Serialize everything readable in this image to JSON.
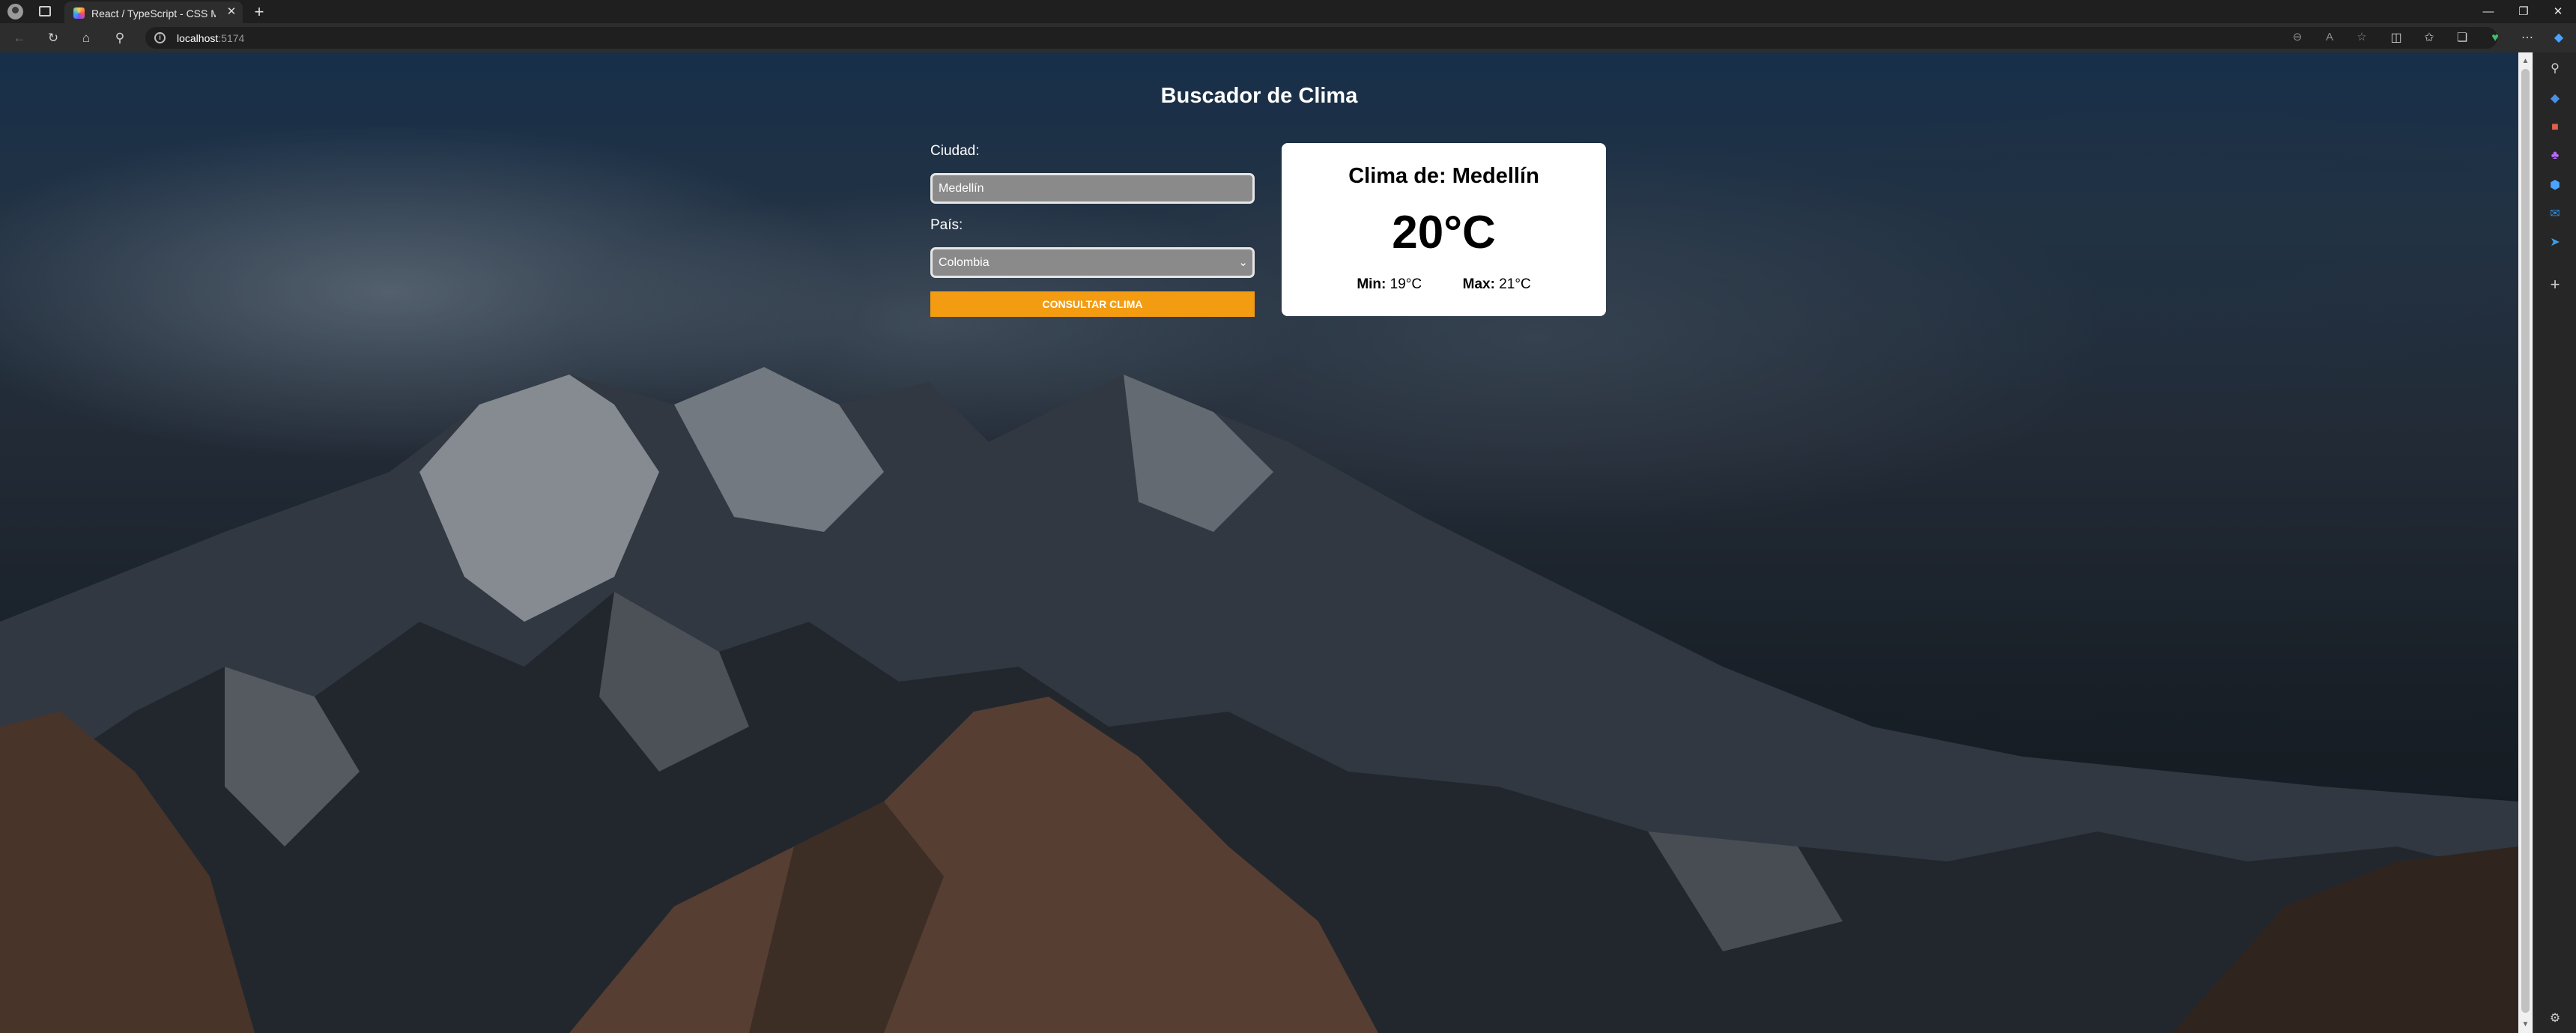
{
  "browser": {
    "tab_title": "React / TypeScript - CSS Modules",
    "tab_close": "✕",
    "new_tab": "+",
    "url_host": "localhost",
    "url_port": ":5174",
    "window_controls": {
      "minimize": "—",
      "maximize": "❐",
      "close": "✕"
    }
  },
  "app": {
    "title": "Buscador de Clima",
    "form": {
      "city_label": "Ciudad:",
      "city_value": "Medellín",
      "country_label": "País:",
      "country_value": "Colombia",
      "submit_label": "Consultar Clima"
    },
    "weather": {
      "title": "Clima de: Medellín",
      "temperature": "20°C",
      "min_label": "Min:",
      "min_value": "19°C",
      "max_label": "Max:",
      "max_value": "21°C"
    }
  },
  "colors": {
    "accent": "#f39c12",
    "card_bg": "#ffffff",
    "input_bg": "#8a8a8a"
  }
}
